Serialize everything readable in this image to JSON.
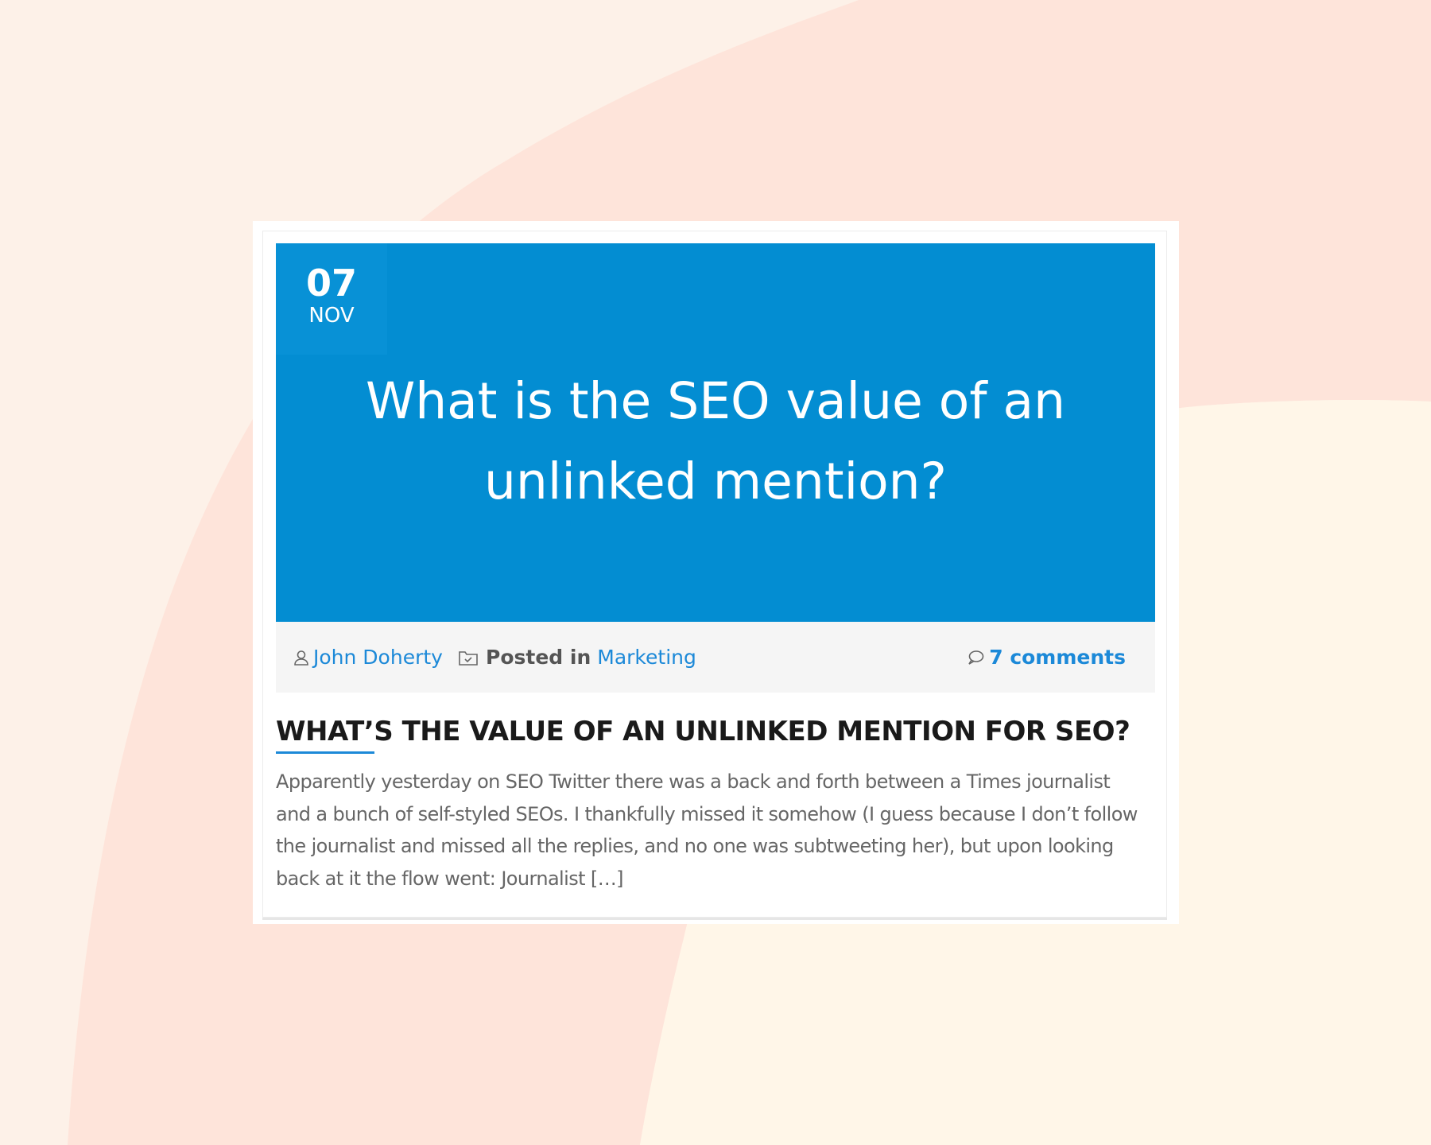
{
  "colors": {
    "background": "#fdf1e8",
    "hero_blue": "#038dd2",
    "link_blue": "#1c89d8",
    "meta_bar": "#f5f5f5"
  },
  "post": {
    "date": {
      "day": "07",
      "month": "NOV"
    },
    "hero_title_line1": "What is the SEO value of an",
    "hero_title_line2": "unlinked mention?",
    "author": "John Doherty",
    "posted_in_label": "Posted in",
    "category": "Marketing",
    "comments": "7 comments",
    "title": "WHAT’S THE VALUE OF AN UNLINKED MENTION FOR SEO?",
    "excerpt_lines": [
      "Apparently yesterday on SEO Twitter there was a back and forth between a Times journalist",
      "and a bunch of self-styled SEOs. I thankfully missed it somehow (I guess because I don’t follow",
      "the journalist and missed all the replies, and no one was subtweeting her), but upon looking",
      "back at it the flow went: Journalist […]"
    ]
  },
  "icons": {
    "author": "user-icon",
    "category": "folder-icon",
    "comments": "comment-bubble-icon"
  }
}
